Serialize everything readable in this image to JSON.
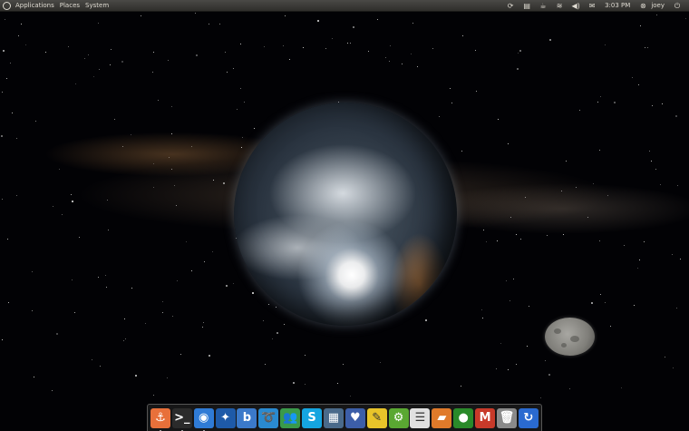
{
  "top_panel": {
    "menus": [
      "Applications",
      "Places",
      "System"
    ],
    "tray": {
      "clock": "3:03 PM",
      "user": "joey",
      "icons": [
        "update-notifier-icon",
        "notes-icon",
        "coffee-icon",
        "wifi-icon",
        "volume-icon",
        "mail-icon"
      ]
    }
  },
  "dock": {
    "items": [
      {
        "name": "awn-manager",
        "glyph": "⚓",
        "bg": "#e8703a"
      },
      {
        "name": "terminal",
        "glyph": ">_",
        "bg": "#2b2b2b"
      },
      {
        "name": "chromium",
        "glyph": "◉",
        "bg": "#2f7bd6"
      },
      {
        "name": "pidgin",
        "glyph": "✦",
        "bg": "#1e5aa8"
      },
      {
        "name": "blogilo",
        "glyph": "b",
        "bg": "#3b79c9"
      },
      {
        "name": "inkscape-swirl",
        "glyph": "➰",
        "bg": "#2a8ad0"
      },
      {
        "name": "empathy",
        "glyph": "👥",
        "bg": "#3a9a4a"
      },
      {
        "name": "skype",
        "glyph": "S",
        "bg": "#15a5e0"
      },
      {
        "name": "system-monitor",
        "glyph": "▦",
        "bg": "#4a6a8a"
      },
      {
        "name": "ubuntu-one",
        "glyph": "♥",
        "bg": "#3c5ea8"
      },
      {
        "name": "notes",
        "glyph": "✎",
        "bg": "#e8c42a"
      },
      {
        "name": "software-center",
        "glyph": "⚙",
        "bg": "#5aa832"
      },
      {
        "name": "text-editor",
        "glyph": "☰",
        "bg": "#e0e0e0"
      },
      {
        "name": "file-manager",
        "glyph": "▰",
        "bg": "#e07a2a"
      },
      {
        "name": "rhythmbox",
        "glyph": "●",
        "bg": "#2a8a2a"
      },
      {
        "name": "gmail",
        "glyph": "M",
        "bg": "#c83a2a"
      },
      {
        "name": "trash",
        "glyph": "🗑",
        "bg": "#8a8a8a"
      },
      {
        "name": "refresh",
        "glyph": "↻",
        "bg": "#2a6ad0"
      }
    ]
  },
  "colors": {
    "panel_text": "#dfdbd2",
    "desktop_bg": "#020205"
  }
}
